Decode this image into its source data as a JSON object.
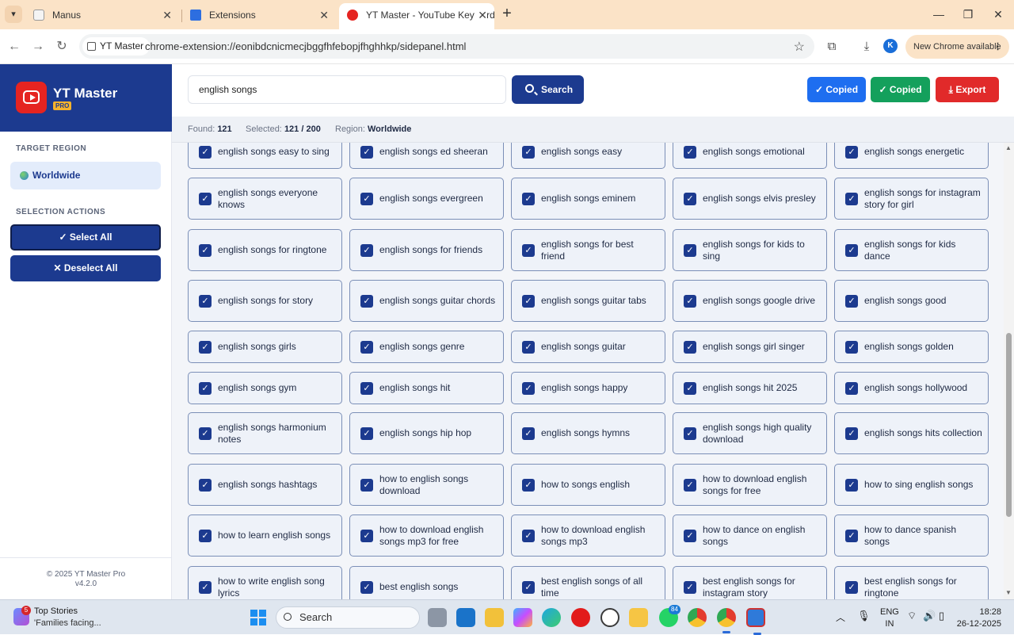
{
  "browser": {
    "tabs": [
      {
        "title": "Manus",
        "active": false
      },
      {
        "title": "Extensions",
        "active": false
      },
      {
        "title": "YT Master - YouTube Keyword T",
        "active": true
      }
    ],
    "site_chip": "YT Master",
    "url": "chrome-extension://eonibdcnicmecjbggfhfebopjfhghhkp/sidepanel.html",
    "profile_initial": "K",
    "update_label": "New Chrome available"
  },
  "sidebar": {
    "app_name": "YT Master",
    "badge": "PRO",
    "target_region_heading": "TARGET REGION",
    "region": "Worldwide",
    "selection_heading": "SELECTION ACTIONS",
    "select_all": "✓  Select All",
    "deselect_all": "✕  Deselect All",
    "footer_line1": "© 2025 YT Master Pro",
    "footer_line2": "v4.2.0"
  },
  "search": {
    "query": "english songs",
    "button": "Search"
  },
  "toolbar_buttons": {
    "copied_1": "✓ Copied",
    "copied_2": "✓ Copied",
    "export": "Export",
    "colors": {
      "blue": "#1e6ef0",
      "green": "#14a05c",
      "red": "#e12a2a"
    }
  },
  "stats": {
    "found_label": "Found:",
    "found_value": "121",
    "selected_label": "Selected:",
    "selected_value": "121 / 200",
    "region_label": "Region:",
    "region_value": "Worldwide"
  },
  "keywords": [
    [
      "english songs easy to sing",
      "english songs ed sheeran",
      "english songs easy",
      "english songs emotional",
      "english songs energetic"
    ],
    [
      "english songs everyone knows",
      "english songs evergreen",
      "english songs eminem",
      "english songs elvis presley",
      "english songs for instagram story for girl"
    ],
    [
      "english songs for ringtone",
      "english songs for friends",
      "english songs for best friend",
      "english songs for kids to sing",
      "english songs for kids dance"
    ],
    [
      "english songs for story",
      "english songs guitar chords",
      "english songs guitar tabs",
      "english songs google drive",
      "english songs good"
    ],
    [
      "english songs girls",
      "english songs genre",
      "english songs guitar",
      "english songs girl singer",
      "english songs golden"
    ],
    [
      "english songs gym",
      "english songs hit",
      "english songs happy",
      "english songs hit 2025",
      "english songs hollywood"
    ],
    [
      "english songs harmonium notes",
      "english songs hip hop",
      "english songs hymns",
      "english songs high quality download",
      "english songs hits collection"
    ],
    [
      "english songs hashtags",
      "how to english songs download",
      "how to songs english",
      "how to download english songs for free",
      "how to sing english songs"
    ],
    [
      "how to learn english songs",
      "how to download english songs mp3 for free",
      "how to download english songs mp3",
      "how to dance on english songs",
      "how to dance spanish songs"
    ],
    [
      "how to write english song lyrics",
      "best english songs",
      "best english songs of all time",
      "best english songs for instagram story",
      "best english songs for ringtone"
    ]
  ],
  "taskbar": {
    "news_badge": "5",
    "news_title": "Top Stories",
    "news_subtitle": "'Families facing...",
    "search_placeholder": "Search",
    "whatsapp_badge": "84",
    "lang_line1": "ENG",
    "lang_line2": "IN",
    "time": "18:28",
    "date": "26-12-2025"
  }
}
